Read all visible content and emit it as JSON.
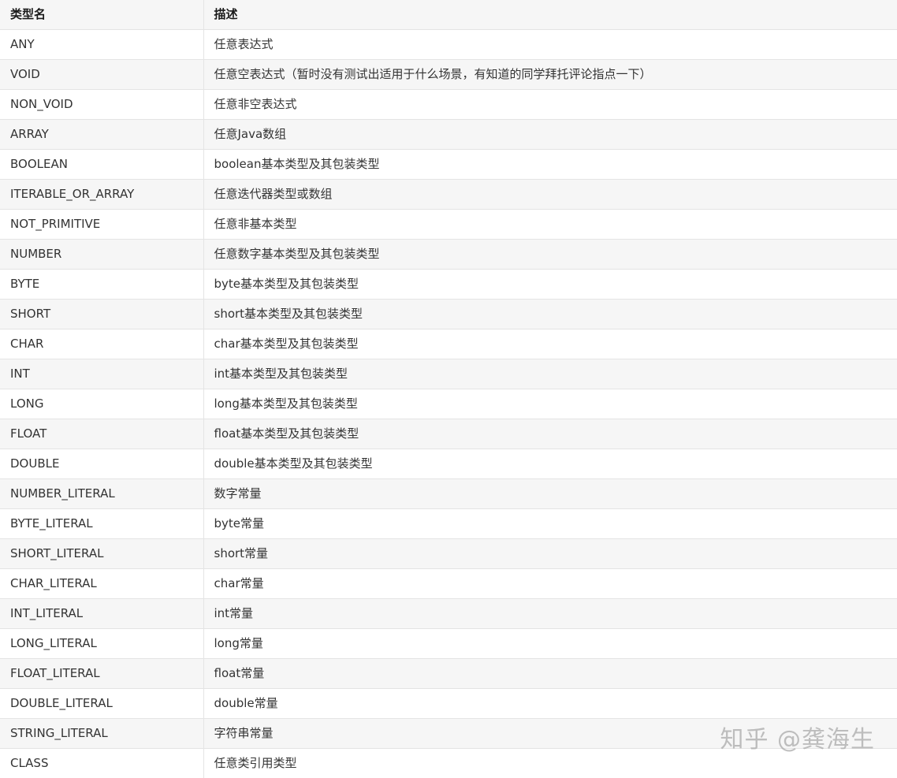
{
  "table": {
    "headers": [
      "类型名",
      "描述"
    ],
    "rows": [
      [
        "ANY",
        "任意表达式"
      ],
      [
        "VOID",
        "任意空表达式（暂时没有测试出适用于什么场景，有知道的同学拜托评论指点一下）"
      ],
      [
        "NON_VOID",
        "任意非空表达式"
      ],
      [
        "ARRAY",
        "任意Java数组"
      ],
      [
        "BOOLEAN",
        "boolean基本类型及其包装类型"
      ],
      [
        "ITERABLE_OR_ARRAY",
        "任意迭代器类型或数组"
      ],
      [
        "NOT_PRIMITIVE",
        "任意非基本类型"
      ],
      [
        "NUMBER",
        "任意数字基本类型及其包装类型"
      ],
      [
        "BYTE",
        "byte基本类型及其包装类型"
      ],
      [
        "SHORT",
        "short基本类型及其包装类型"
      ],
      [
        "CHAR",
        "char基本类型及其包装类型"
      ],
      [
        "INT",
        "int基本类型及其包装类型"
      ],
      [
        "LONG",
        "long基本类型及其包装类型"
      ],
      [
        "FLOAT",
        "float基本类型及其包装类型"
      ],
      [
        "DOUBLE",
        "double基本类型及其包装类型"
      ],
      [
        "NUMBER_LITERAL",
        "数字常量"
      ],
      [
        "BYTE_LITERAL",
        "byte常量"
      ],
      [
        "SHORT_LITERAL",
        "short常量"
      ],
      [
        "CHAR_LITERAL",
        "char常量"
      ],
      [
        "INT_LITERAL",
        "int常量"
      ],
      [
        "LONG_LITERAL",
        "long常量"
      ],
      [
        "FLOAT_LITERAL",
        "float常量"
      ],
      [
        "DOUBLE_LITERAL",
        "double常量"
      ],
      [
        "STRING_LITERAL",
        "字符串常量"
      ],
      [
        "CLASS",
        "任意类引用类型"
      ]
    ]
  },
  "watermark": "知乎 @龚海生"
}
